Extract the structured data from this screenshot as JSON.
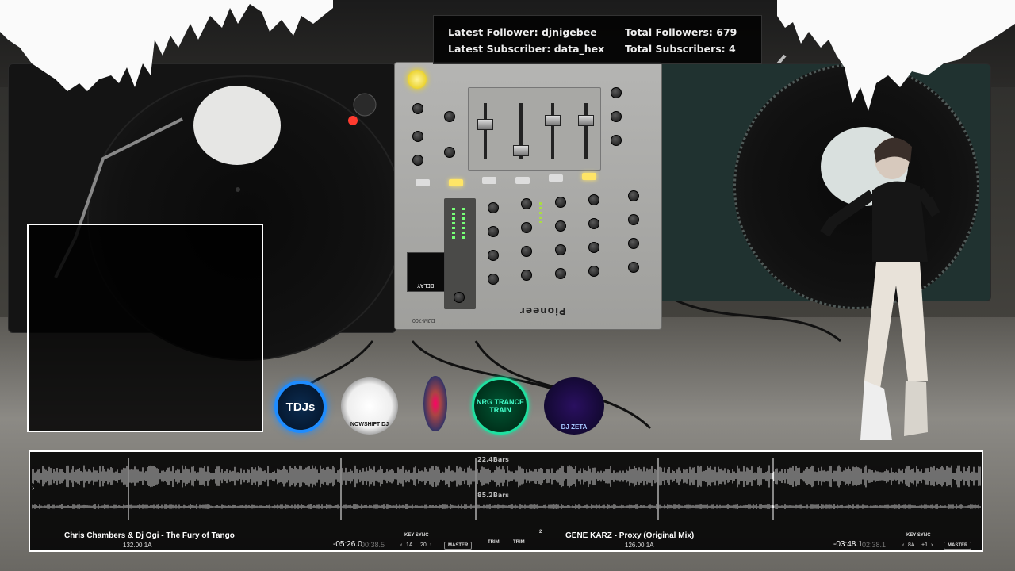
{
  "overlay": {
    "latest_follower": "Latest Follower: djnigebee",
    "total_followers": "Total Followers: 679",
    "latest_subscriber": "Latest Subscriber: data_hex",
    "total_subscribers": "Total Subscribers: 4"
  },
  "mixer": {
    "brand": "Pioneer",
    "model": "DJM-700",
    "delay_display": "DELAY"
  },
  "logos": {
    "tdj": "TDJs",
    "owl": "NOWSHIFT DJ",
    "nrg": "NRG TRANCE TRAIN",
    "zeta": "DJ ZETA"
  },
  "waveform": {
    "upper_bars": "22.4Bars",
    "lower_bars": "85.2Bars"
  },
  "deck_a": {
    "title": "Chris Chambers & Dj Ogi - The Fury of Tango",
    "bpm_key": "132.00  1A",
    "time_remaining": "-05:26.0",
    "time_elapsed": "00:38.5",
    "key_sync": "KEY SYNC",
    "key_value": "1A",
    "pitch_range": "20",
    "master": "MASTER",
    "trim": "TRIM"
  },
  "deck_b": {
    "title": "GENE KARZ - Proxy (Original Mix)",
    "bpm_key": "126.00  1A",
    "time_remaining": "-03:48.1",
    "time_elapsed": "02:38.1",
    "key_sync": "KEY SYNC",
    "key_value": "8A",
    "pitch_range": "+1",
    "master": "MASTER",
    "trim": "TRIM",
    "deck_number": "2"
  },
  "colors": {
    "accent_yellow": "#ffe566",
    "deck_border": "#ffffff",
    "logo_blue": "#1e8cff",
    "logo_green": "#1fe0a0"
  }
}
